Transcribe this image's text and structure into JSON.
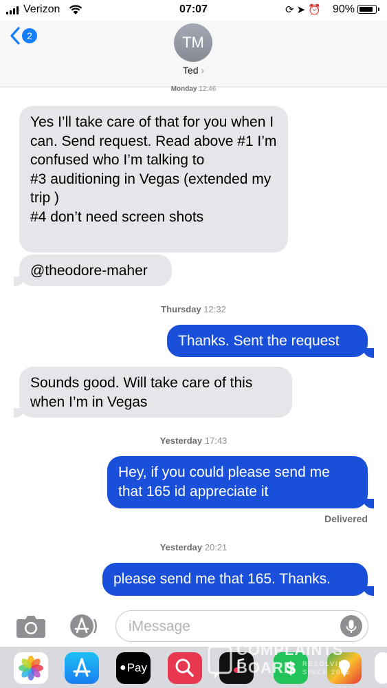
{
  "status_bar": {
    "carrier": "Verizon",
    "time": "07:07",
    "battery_percent": "90%",
    "battery_level": 0.9,
    "icons": [
      "rotation-lock-icon",
      "location-icon",
      "alarm-icon"
    ]
  },
  "header": {
    "back_badge": "2",
    "avatar_initials": "TM",
    "contact_name": "Ted",
    "contact_chevron": "›"
  },
  "messages": [
    {
      "type": "timestamp",
      "day": "Monday",
      "time": "12:46"
    },
    {
      "type": "incoming",
      "text": "Yes I’ll take care of that for you when I can. Send request. Read above #1 I’m confused who I’m talking to\n#3 auditioning in Vegas (extended my trip )\n#4 don’t need screen shots"
    },
    {
      "type": "incoming",
      "text": "@theodore-maher"
    },
    {
      "type": "timestamp",
      "day": "Thursday",
      "time": "12:32"
    },
    {
      "type": "outgoing",
      "text": "Thanks. Sent the request"
    },
    {
      "type": "incoming",
      "text": "Sounds good. Will take care of this when I’m in Vegas"
    },
    {
      "type": "timestamp",
      "day": "Yesterday",
      "time": "17:43"
    },
    {
      "type": "outgoing",
      "text": "Hey, if you could please send me that 165 id appreciate it"
    },
    {
      "type": "status",
      "text": "Delivered"
    },
    {
      "type": "timestamp",
      "day": "Yesterday",
      "time": "20:21"
    },
    {
      "type": "outgoing",
      "text": "please send me that 165. Thanks."
    }
  ],
  "composer": {
    "placeholder": "iMessage"
  },
  "app_drawer": {
    "apple_pay_label": "Pay",
    "apps": [
      "photos-app-icon",
      "app-store-icon",
      "apple-pay-icon",
      "search-images-icon",
      "music-app-icon",
      "cash-app-icon",
      "maps-app-icon"
    ]
  },
  "watermark": {
    "line1": "COMPLAINTS",
    "line2": "BOARD",
    "line3": "RESOLVING",
    "line4": "SINCE 2006"
  },
  "colors": {
    "accent": "#147efb",
    "outgoing_bubble": "#1a4fd9",
    "incoming_bubble": "#e5e5ea"
  }
}
